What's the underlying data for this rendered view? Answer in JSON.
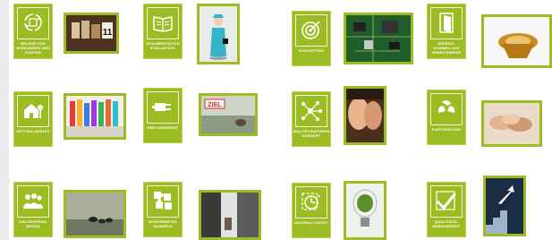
{
  "colors": {
    "accent": "#9cbc23",
    "tile_border": "#b8cf4f",
    "sidebar": "#e9eaeb"
  },
  "tiles": [
    {
      "label": "BELEGE FÜR\nWIRKUNGEN UND\nKOSTEN",
      "icon": "cycle-icon"
    },
    {
      "label": "DOKUMENTATION\nEVALUATION",
      "icon": "book-icon"
    },
    {
      "label": "KONZEPTION",
      "icon": "target-icon"
    },
    {
      "label": "NIEDRIG-\nSCHWELLIGE\nARBEITSWEISE",
      "icon": "door-icon"
    },
    {
      "label": "SETTING-ANSATZ",
      "icon": "house-icon"
    },
    {
      "label": "EMPOWERMENT",
      "icon": "plug-icon"
    },
    {
      "label": "MULTIPLIKATOREN-\nKONZEPT",
      "icon": "network-icon"
    },
    {
      "label": "PARTIZIPATION",
      "icon": "hands-icon"
    },
    {
      "label": "ZIELGRUPPEN-\nBEZUG",
      "icon": "people-icon"
    },
    {
      "label": "INTEGRIERTES\nHANDELN",
      "icon": "puzzle-icon"
    },
    {
      "label": "NACHHALTIGKEIT",
      "icon": "clock-icon"
    },
    {
      "label": "QUALITÄTS-\nMANAGEMENT",
      "icon": "checkmark-icon"
    }
  ],
  "photos": {
    "numbers_sign": "11",
    "goal_sign": "ZIEL"
  }
}
